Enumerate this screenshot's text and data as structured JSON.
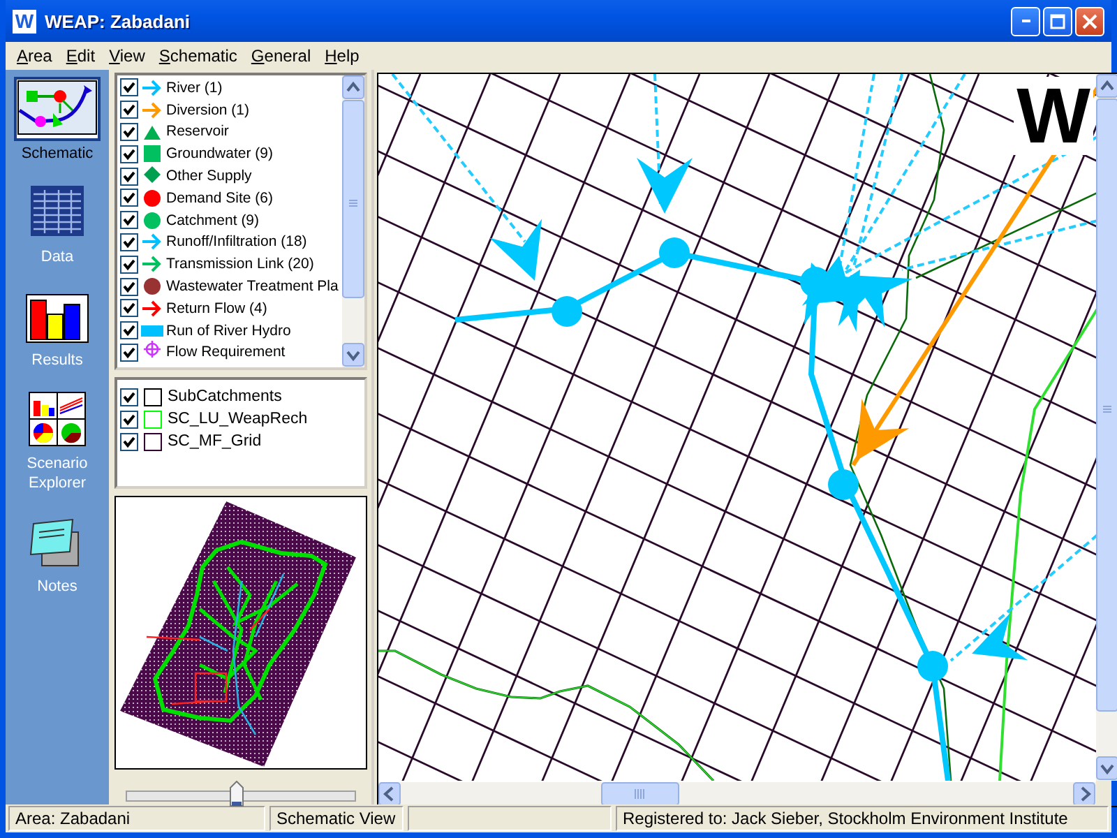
{
  "window": {
    "logo": "W",
    "title": "WEAP: Zabadani"
  },
  "menu": [
    "Area",
    "Edit",
    "View",
    "Schematic",
    "General",
    "Help"
  ],
  "views": [
    {
      "label": "Schematic",
      "kind": "schematic",
      "selected": true
    },
    {
      "label": "Data",
      "kind": "data",
      "selected": false
    },
    {
      "label": "Results",
      "kind": "results",
      "selected": false
    },
    {
      "label": "Scenario Explorer",
      "kind": "scenarios",
      "selected": false
    },
    {
      "label": "Notes",
      "kind": "notes",
      "selected": false
    }
  ],
  "legend": [
    {
      "label": "River (1)",
      "kind": "arrow",
      "color": "#00c0ff",
      "checked": true
    },
    {
      "label": "Diversion (1)",
      "kind": "arrow",
      "color": "#ff9900",
      "checked": true
    },
    {
      "label": "Reservoir",
      "kind": "triangle",
      "color": "#00b050",
      "checked": true
    },
    {
      "label": "Groundwater (9)",
      "kind": "square",
      "color": "#00c060",
      "checked": true
    },
    {
      "label": "Other Supply",
      "kind": "diamond",
      "color": "#00a050",
      "checked": true
    },
    {
      "label": "Demand Site (6)",
      "kind": "circle",
      "color": "#ff0000",
      "checked": true
    },
    {
      "label": "Catchment (9)",
      "kind": "circle",
      "color": "#00c060",
      "checked": true
    },
    {
      "label": "Runoff/Infiltration (18)",
      "kind": "arrow",
      "color": "#00c0ff",
      "checked": true
    },
    {
      "label": "Transmission Link (20)",
      "kind": "arrow",
      "color": "#00c060",
      "checked": true
    },
    {
      "label": "Wastewater Treatment Pla",
      "kind": "circle",
      "color": "#993333",
      "checked": true
    },
    {
      "label": "Return Flow (4)",
      "kind": "arrow",
      "color": "#ff0000",
      "checked": true
    },
    {
      "label": "Run of River Hydro",
      "kind": "bar",
      "color": "#00c0ff",
      "checked": true
    },
    {
      "label": "Flow Requirement",
      "kind": "crosshair",
      "color": "#cc33ff",
      "checked": true
    }
  ],
  "layers": [
    {
      "label": "SubCatchments",
      "color": "#000000",
      "checked": true
    },
    {
      "label": "SC_LU_WeapRech",
      "color": "#00ff00",
      "checked": true
    },
    {
      "label": "SC_MF_Grid",
      "color": "#330033",
      "checked": true
    }
  ],
  "zoom_slider": {
    "level": 0.48
  },
  "map": {
    "label": "W"
  },
  "status_bar": [
    "Area:  Zabadani",
    "Schematic View",
    "Registered to: Jack Sieber, Stockholm Environment Institute"
  ]
}
